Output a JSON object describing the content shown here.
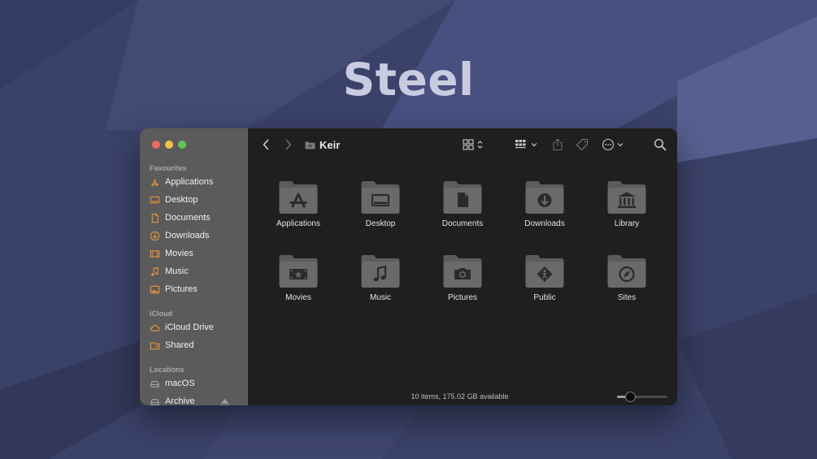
{
  "hero": {
    "title": "Steel"
  },
  "window": {
    "path_title": "Keir",
    "sidebar": {
      "sections": [
        {
          "heading": "Favourites",
          "items": [
            {
              "label": "Applications",
              "icon": "applications-icon"
            },
            {
              "label": "Desktop",
              "icon": "desktop-icon"
            },
            {
              "label": "Documents",
              "icon": "document-icon"
            },
            {
              "label": "Downloads",
              "icon": "download-icon"
            },
            {
              "label": "Movies",
              "icon": "film-icon"
            },
            {
              "label": "Music",
              "icon": "music-note-icon"
            },
            {
              "label": "Pictures",
              "icon": "picture-icon"
            }
          ]
        },
        {
          "heading": "iCloud",
          "items": [
            {
              "label": "iCloud Drive",
              "icon": "cloud-icon"
            },
            {
              "label": "Shared",
              "icon": "shared-folder-icon"
            }
          ]
        },
        {
          "heading": "Locations",
          "items": [
            {
              "label": "macOS",
              "icon": "disk-icon"
            },
            {
              "label": "Archive",
              "icon": "disk-icon",
              "eject": "eject-icon"
            }
          ]
        }
      ]
    },
    "items": [
      {
        "label": "Applications",
        "glyph": "app-store-glyph"
      },
      {
        "label": "Desktop",
        "glyph": "monitor-glyph"
      },
      {
        "label": "Documents",
        "glyph": "document-glyph"
      },
      {
        "label": "Downloads",
        "glyph": "download-glyph"
      },
      {
        "label": "Library",
        "glyph": "library-glyph"
      },
      {
        "label": "Movies",
        "glyph": "film-glyph"
      },
      {
        "label": "Music",
        "glyph": "music-glyph"
      },
      {
        "label": "Pictures",
        "glyph": "camera-glyph"
      },
      {
        "label": "Public",
        "glyph": "public-glyph"
      },
      {
        "label": "Sites",
        "glyph": "compass-glyph"
      }
    ],
    "status": "10 items, 175.02 GB available",
    "icon_size_level": 0.25,
    "colors": {
      "accent": "#e8943a",
      "folder_top": "#6a6a6a",
      "folder_bottom": "#4e4e4e",
      "glyph": "#2a2a2a"
    }
  }
}
